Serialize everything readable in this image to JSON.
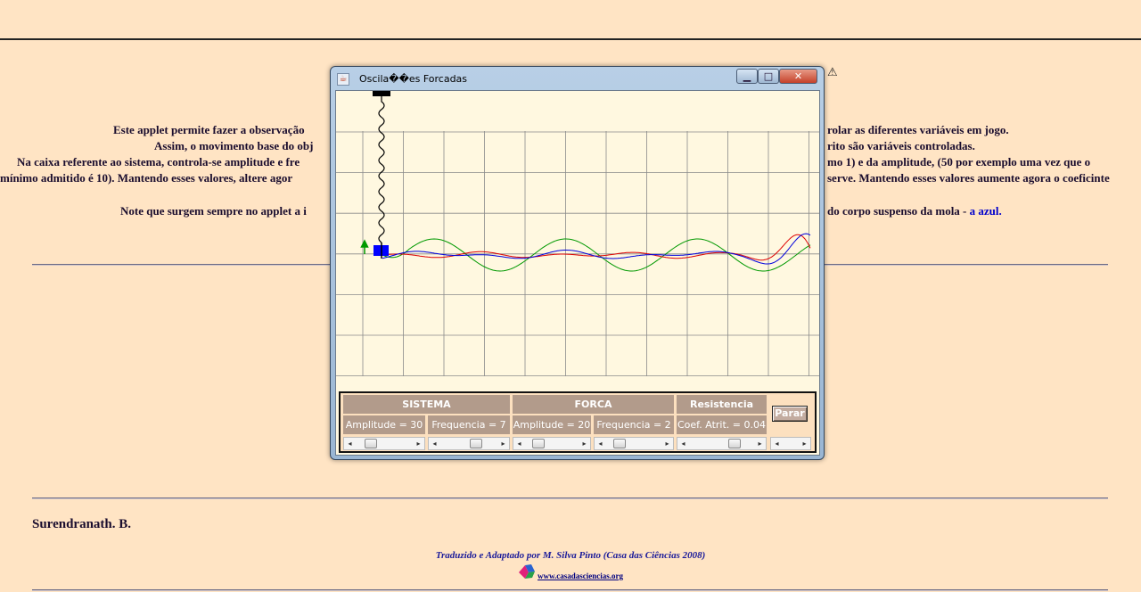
{
  "page": {
    "title_bg": "Oscilações Forçadas",
    "paragraph_lines": [
      "Este applet permite fazer a observação",
      "Assim, o movimento base do obj",
      "Na caixa referente ao sistema, controla-se amplitude e fre",
      "mínimo admitido é 10). Mantendo esses valores, altere agor",
      "Note que surgem sempre no applet a i"
    ],
    "paragraph_right": [
      "rolar as diferentes variáveis em jogo.",
      "rito são variáveis controladas.",
      "mo 1) e da amplitude, (50 por exemplo uma vez que o",
      "serve. Mantendo esses valores aumente agora o coeficinte"
    ],
    "note_right_text": "do corpo suspenso da mola - ",
    "note_right_blue": "a azul.",
    "author": "Surendranath. B.",
    "credits": "Traduzido e Adaptado por M. Silva Pinto (Casa das Ciências 2008)",
    "site_link": "www.casadasciencias.org"
  },
  "applet": {
    "window_title": "Oscila��es Forcadas",
    "buttons": {
      "minimize": "▁",
      "maximize": "□",
      "close": "✕"
    },
    "warning_icon": "warning-triangle-icon",
    "controls": {
      "sistema_header": "SISTEMA",
      "forca_header": "FORCA",
      "resistencia_header": "Resistencia",
      "sistema_amplitude": "Amplitude = 30",
      "sistema_frequencia": "Frequencia = 7",
      "forca_amplitude": "Amplitude = 20",
      "forca_frequencia": "Frequencia = 2",
      "coef_atrito": "Coef. Atrit. =  0.04",
      "stop_label": "Parar"
    },
    "colors": {
      "canvas_bg": "#fff8e0",
      "grid": "#8a8a8a",
      "force_curve": "#009900",
      "system_curve": "#dd0000",
      "body_curve": "#0000dd",
      "mass": "#0000ff"
    }
  }
}
